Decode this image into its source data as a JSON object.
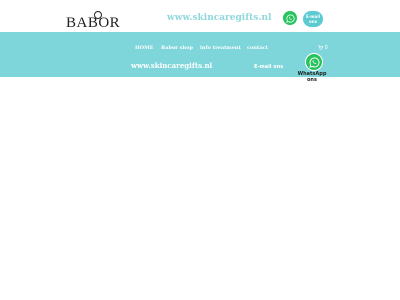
{
  "header": {
    "logo_text": "BABOR",
    "site_url": "www.skincaregifts.nl",
    "email_button_label": "E-mail ons"
  },
  "nav": {
    "items": [
      {
        "label": "HOME"
      },
      {
        "label": "Babor shop"
      },
      {
        "label": "info treatment"
      },
      {
        "label": "contact"
      }
    ],
    "cart_count": "0"
  },
  "band": {
    "site_url": "www.skincaregifts.nl",
    "email_label": "E-mail ons"
  },
  "floating": {
    "whatsapp_label": "WhatsApp ons"
  },
  "colors": {
    "accent": "#7fd6da",
    "whatsapp": "#27c35e",
    "site_text": "#8fd8dc"
  },
  "icons": [
    "whatsapp-icon",
    "cart-icon",
    "logo-mark-icon"
  ]
}
